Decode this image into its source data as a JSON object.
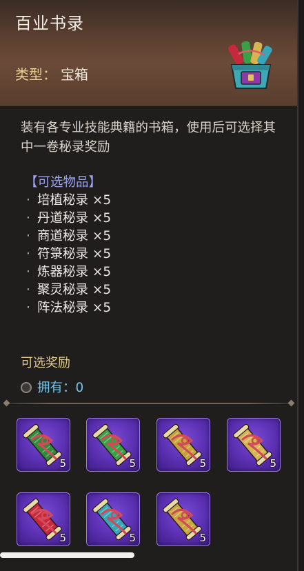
{
  "header": {
    "title": "百业书录",
    "type_label": "类型：",
    "type_value": "宝箱",
    "chest_icon": "treasure-chest-of-scrolls"
  },
  "description": "装有各专业技能典籍的书箱，使用后可选择其中一卷秘录奖励",
  "options": {
    "title": "【可选物品】",
    "bullet": "·",
    "items": [
      "培植秘录 ×5",
      "丹道秘录 ×5",
      "商道秘录 ×5",
      "符箓秘录 ×5",
      "炼器秘录 ×5",
      "聚灵秘录 ×5",
      "阵法秘录 ×5"
    ]
  },
  "rewards": {
    "title": "可选奖励",
    "owned_label": "拥有：",
    "owned_value": "0",
    "slots": [
      {
        "icon": "scroll-icon",
        "body": "#2f8a3a",
        "tie": "#d24a5a",
        "count": "5"
      },
      {
        "icon": "scroll-icon",
        "body": "#3aa046",
        "tie": "#d24a5a",
        "count": "5"
      },
      {
        "icon": "scroll-icon",
        "body": "#c7a43a",
        "tie": "#d24a5a",
        "count": "5"
      },
      {
        "icon": "scroll-icon",
        "body": "#d6b452",
        "tie": "#d24a5a",
        "count": "5"
      },
      {
        "icon": "scroll-icon",
        "body": "#c8283c",
        "tie": "#d24a5a",
        "count": "5"
      },
      {
        "icon": "scroll-icon",
        "body": "#36a6b8",
        "tie": "#d24a5a",
        "count": "5"
      },
      {
        "icon": "scroll-icon",
        "body": "#c9a640",
        "tie": "#d24a5a",
        "count": "5"
      }
    ]
  },
  "colors": {
    "accent_gold": "#e2c984",
    "option_title": "#9aa0f0",
    "owned": "#6fc3ee",
    "slot_purple": "#5a2fb0"
  }
}
